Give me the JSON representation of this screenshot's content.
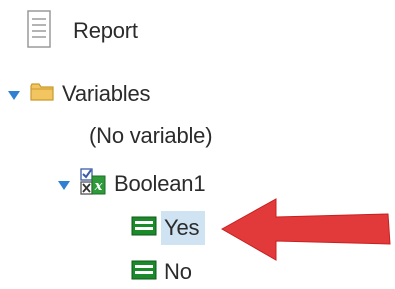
{
  "tree": {
    "report": {
      "label": "Report",
      "icon": "document-icon"
    },
    "variables": {
      "label": "Variables",
      "icon": "folder-icon",
      "expanded": true,
      "children": {
        "no_variable": {
          "label": "(No variable)"
        },
        "boolean1": {
          "label": "Boolean1",
          "icon": "boolean-variable-icon",
          "expanded": true,
          "values": [
            {
              "label": "Yes",
              "icon": "value-icon",
              "selected": true
            },
            {
              "label": "No",
              "icon": "value-icon",
              "selected": false
            }
          ]
        }
      }
    }
  },
  "annotation": {
    "icon": "red-arrow-icon",
    "color": "#e23a3a"
  },
  "colors": {
    "expander": "#2f7fd2",
    "selection": "#cfe3f3",
    "folder": "#f3c561",
    "value_icon": "#1a8a2a"
  }
}
